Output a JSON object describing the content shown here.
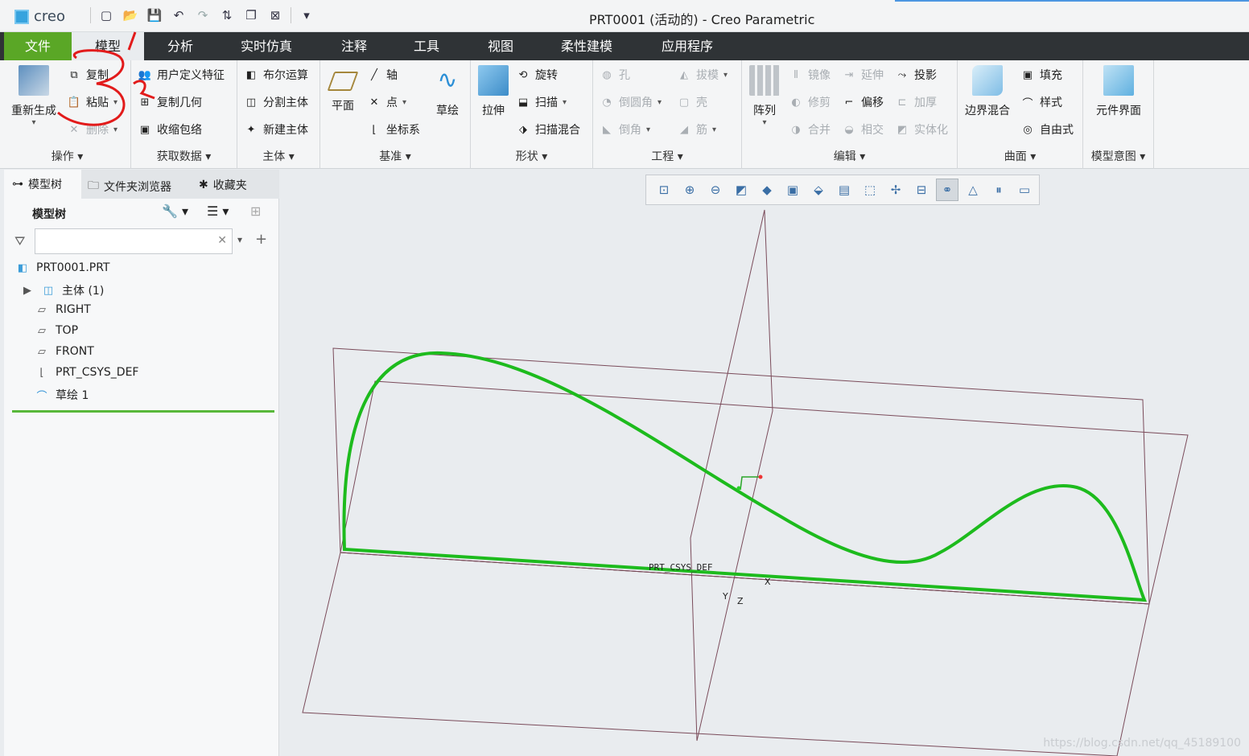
{
  "titlebar": {
    "logo_text": "creo",
    "window_title": "PRT0001 (活动的) - Creo Parametric",
    "quick_access": [
      "new-icon",
      "open-icon",
      "save-icon",
      "undo-icon",
      "redo-icon",
      "regenerate-icon",
      "windows-icon",
      "close-icon",
      "customize-icon"
    ]
  },
  "menubar": {
    "items": [
      "文件",
      "模型",
      "分析",
      "实时仿真",
      "注释",
      "工具",
      "视图",
      "柔性建模",
      "应用程序"
    ],
    "active": "模型"
  },
  "ribbon": {
    "groups": {
      "operations": {
        "label": "操作",
        "regenerate": "重新生成",
        "copy": "复制",
        "paste": "粘贴",
        "delete": "删除"
      },
      "get_data": {
        "label": "获取数据",
        "udf": "用户定义特征",
        "copy_geom": "复制几何",
        "shrinkwrap": "收缩包络"
      },
      "body": {
        "label": "主体",
        "boolean": "布尔运算",
        "split": "分割主体",
        "new_body": "新建主体"
      },
      "datum": {
        "label": "基准",
        "plane": "平面",
        "axis": "轴",
        "point": "点",
        "csys": "坐标系",
        "sketch": "草绘"
      },
      "shapes": {
        "label": "形状",
        "extrude": "拉伸",
        "revolve": "旋转",
        "sweep": "扫描",
        "swept_blend": "扫描混合"
      },
      "engineering": {
        "label": "工程",
        "hole": "孔",
        "draft": "拔模",
        "round": "倒圆角",
        "shell": "壳",
        "chamfer": "倒角",
        "rib": "筋"
      },
      "editing": {
        "label": "编辑",
        "pattern": "阵列",
        "mirror": "镜像",
        "extend": "延伸",
        "project": "投影",
        "trim": "修剪",
        "offset": "偏移",
        "thicken": "加厚",
        "merge": "合并",
        "intersect": "相交",
        "solidify": "实体化"
      },
      "surfaces": {
        "label": "曲面",
        "boundary_blend": "边界混合",
        "fill": "填充",
        "style": "样式",
        "freestyle": "自由式"
      },
      "model_intent": {
        "label": "模型意图",
        "component_interface": "元件界面"
      }
    }
  },
  "left_panel": {
    "tabs": [
      "模型树",
      "文件夹浏览器",
      "收藏夹"
    ],
    "tree_header": "模型树",
    "search_placeholder": "",
    "tree": [
      "PRT0001.PRT",
      "主体 (1)",
      "RIGHT",
      "TOP",
      "FRONT",
      "PRT_CSYS_DEF",
      "草绘 1"
    ]
  },
  "viewport": {
    "csys_label": "PRT_CSYS_DEF",
    "axis_x": "X",
    "axis_y": "Y",
    "axis_z": "Z",
    "watermark": "https://blog.csdn.net/qq_45189100",
    "curve_color": "#1dbb1d",
    "datum_color": "#7a4b5a"
  },
  "annotations": {
    "mark_1": "1",
    "mark_2": "2"
  }
}
